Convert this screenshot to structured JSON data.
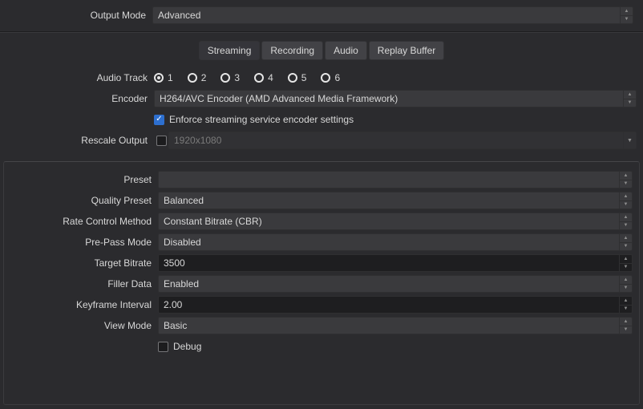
{
  "top": {
    "output_mode_label": "Output Mode",
    "output_mode_value": "Advanced"
  },
  "tabs": {
    "streaming": "Streaming",
    "recording": "Recording",
    "audio": "Audio",
    "replay_buffer": "Replay Buffer"
  },
  "stream": {
    "audio_track_label": "Audio Track",
    "audio_tracks": [
      "1",
      "2",
      "3",
      "4",
      "5",
      "6"
    ],
    "audio_track_selected": 0,
    "encoder_label": "Encoder",
    "encoder_value": "H264/AVC Encoder (AMD Advanced Media Framework)",
    "enforce_label": "Enforce streaming service encoder settings",
    "enforce_checked": true,
    "rescale_label": "Rescale Output",
    "rescale_checked": false,
    "rescale_placeholder": "1920x1080"
  },
  "encoder": {
    "preset_label": "Preset",
    "preset_value": "",
    "quality_preset_label": "Quality Preset",
    "quality_preset_value": "Balanced",
    "rate_control_label": "Rate Control Method",
    "rate_control_value": "Constant Bitrate (CBR)",
    "prepass_label": "Pre-Pass Mode",
    "prepass_value": "Disabled",
    "target_bitrate_label": "Target Bitrate",
    "target_bitrate_value": "3500",
    "filler_label": "Filler Data",
    "filler_value": "Enabled",
    "keyframe_label": "Keyframe Interval",
    "keyframe_value": "2.00",
    "view_mode_label": "View Mode",
    "view_mode_value": "Basic",
    "debug_label": "Debug",
    "debug_checked": false
  }
}
